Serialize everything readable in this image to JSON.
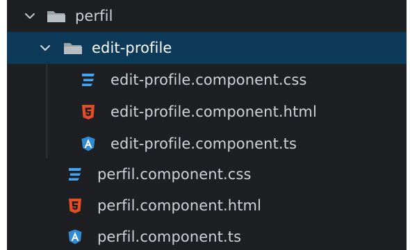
{
  "explorer": {
    "tree": [
      {
        "label": "perfil",
        "kind": "folder",
        "expanded": true,
        "level": 0,
        "icon": "folder-open-icon"
      },
      {
        "label": "edit-profile",
        "kind": "folder",
        "expanded": true,
        "level": 1,
        "selected": true,
        "icon": "folder-open-icon"
      },
      {
        "label": "edit-profile.component.css",
        "kind": "file",
        "level": 2,
        "icon": "css-icon"
      },
      {
        "label": "edit-profile.component.html",
        "kind": "file",
        "level": 2,
        "icon": "html-icon"
      },
      {
        "label": "edit-profile.component.ts",
        "kind": "file",
        "level": 2,
        "icon": "angular-icon"
      },
      {
        "label": "perfil.component.css",
        "kind": "file",
        "level": 1,
        "icon": "css-icon"
      },
      {
        "label": "perfil.component.html",
        "kind": "file",
        "level": 1,
        "icon": "html-icon"
      },
      {
        "label": "perfil.component.ts",
        "kind": "file",
        "level": 1,
        "icon": "angular-icon"
      }
    ]
  },
  "colors": {
    "background": "#1e1f22",
    "selection": "#0d3a58",
    "css": "#42a5f5",
    "html": "#e44d26",
    "angular": "#2e8bd6"
  }
}
